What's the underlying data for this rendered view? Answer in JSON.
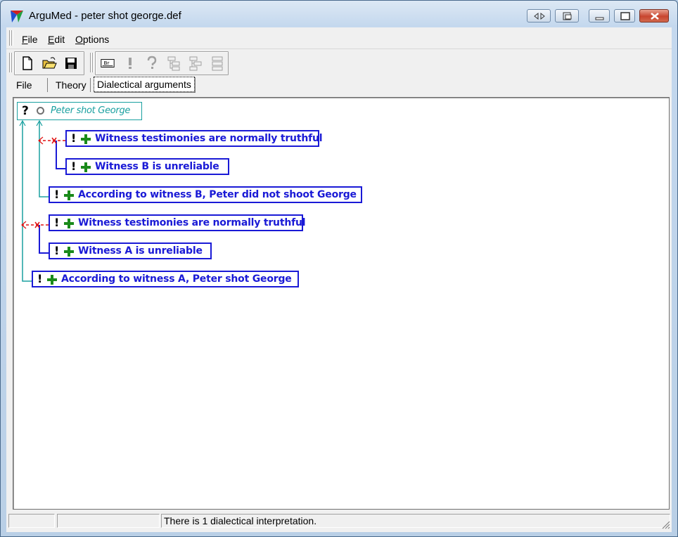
{
  "window": {
    "title": "ArguMed - peter shot george.def"
  },
  "menu": {
    "items": [
      "File",
      "Edit",
      "Options"
    ]
  },
  "toolbar": {
    "buttons": [
      "new-icon",
      "open-folder-icon",
      "save-icon",
      "br-icon",
      "exclamation-icon",
      "question-icon",
      "tree-left-icon",
      "tree-right-icon",
      "tree-list-icon"
    ],
    "br_text": "Br"
  },
  "tabs": [
    {
      "label": "File",
      "active": false
    },
    {
      "label": "Theory",
      "active": false
    },
    {
      "label": "Dialectical arguments",
      "active": true
    }
  ],
  "argument_tree": {
    "root": {
      "marker": "?",
      "text": "Peter shot George"
    },
    "nodes": [
      {
        "marker": "!",
        "text": "Witness testimonies are normally truthful"
      },
      {
        "marker": "!",
        "text": "Witness B is unreliable"
      },
      {
        "marker": "!",
        "text": "According to witness B, Peter did not shoot George"
      },
      {
        "marker": "!",
        "text": "Witness testimonies are normally truthful"
      },
      {
        "marker": "!",
        "text": "Witness A is unreliable"
      },
      {
        "marker": "!",
        "text": "According to witness A, Peter shot George"
      }
    ],
    "colors": {
      "node_border": "#1a1ad6",
      "root_border": "#1aa0a0",
      "support_link": "#1aa0a0",
      "undercut_link": "#1a1ad6",
      "attack_arrow": "#e01010",
      "plus": "#1a8a1a"
    }
  },
  "status": {
    "message": "There is 1 dialectical interpretation."
  }
}
